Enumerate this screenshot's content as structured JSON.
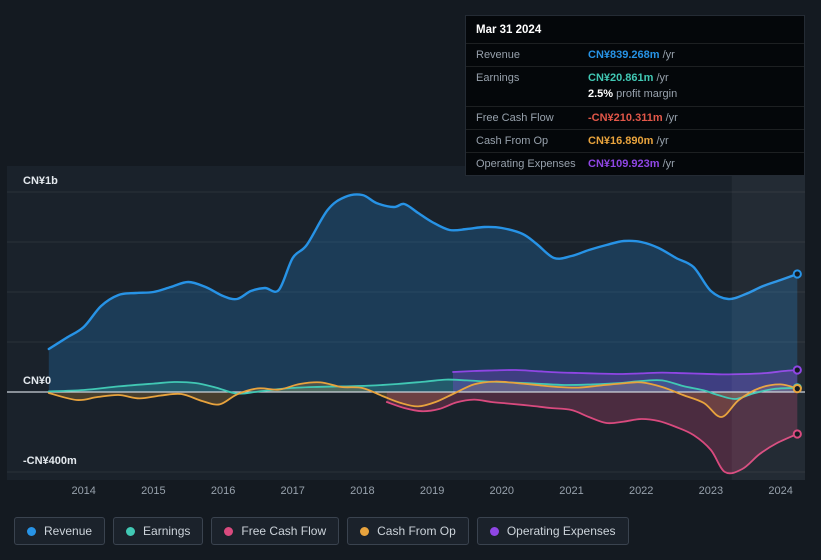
{
  "colors": {
    "page-bg": "#141a21",
    "plot-bg": "#1a222b",
    "revenue": "#2793e6",
    "earnings": "#41c8b4",
    "fcf": "#d94a7e",
    "fcf-neg": "#e25749",
    "cashop": "#e8a33d",
    "opex": "#8f46e4",
    "zero-line": "#ccd3da",
    "text": "#e4e9ee",
    "text-muted": "#97a1ac"
  },
  "tooltip": {
    "date": "Mar 31 2024",
    "rows": [
      {
        "label": "Revenue",
        "value": "CN¥839.268m",
        "suffix": "/yr"
      },
      {
        "label": "Earnings",
        "value": "CN¥20.861m",
        "suffix": "/yr"
      },
      {
        "label": "Free Cash Flow",
        "value": "-CN¥210.311m",
        "suffix": "/yr"
      },
      {
        "label": "Cash From Op",
        "value": "CN¥16.890m",
        "suffix": "/yr"
      },
      {
        "label": "Operating Expenses",
        "value": "CN¥109.923m",
        "suffix": "/yr"
      }
    ],
    "profit_margin": {
      "value": "2.5%",
      "text": "profit margin"
    }
  },
  "legend": [
    {
      "label": "Revenue",
      "color_key": "revenue"
    },
    {
      "label": "Earnings",
      "color_key": "earnings"
    },
    {
      "label": "Free Cash Flow",
      "color_key": "fcf"
    },
    {
      "label": "Cash From Op",
      "color_key": "cashop"
    },
    {
      "label": "Operating Expenses",
      "color_key": "opex"
    }
  ],
  "chart_data": {
    "type": "area",
    "unit": "CN¥ millions per year",
    "xlim": [
      2012.9,
      2024.35
    ],
    "ylim": [
      -440,
      1130
    ],
    "x_ticks": [
      2014,
      2015,
      2016,
      2017,
      2018,
      2019,
      2020,
      2021,
      2022,
      2023,
      2024
    ],
    "y_ticks": [
      {
        "value": 1000,
        "label": "CN¥1b"
      },
      {
        "value": 0,
        "label": "CN¥0"
      },
      {
        "value": -400,
        "label": "-CN¥400m"
      }
    ],
    "grid_values": [
      1000,
      750,
      500,
      250,
      -400
    ],
    "highlight_band": [
      2023.3,
      2024.35
    ],
    "legend_position": "bottom-left",
    "series": [
      {
        "name": "Revenue",
        "color_key": "revenue",
        "x": [
          2013.5,
          2013.75,
          2014,
          2014.25,
          2014.5,
          2014.75,
          2015,
          2015.25,
          2015.5,
          2015.75,
          2016,
          2016.2,
          2016.4,
          2016.6,
          2016.8,
          2017,
          2017.2,
          2017.5,
          2017.75,
          2018,
          2018.2,
          2018.45,
          2018.6,
          2018.8,
          2019,
          2019.25,
          2019.5,
          2019.75,
          2020,
          2020.3,
          2020.5,
          2020.75,
          2021,
          2021.25,
          2021.5,
          2021.75,
          2022,
          2022.25,
          2022.5,
          2022.75,
          2023,
          2023.25,
          2023.5,
          2023.75,
          2024,
          2024.24
        ],
        "values": [
          215,
          270,
          325,
          430,
          485,
          495,
          500,
          525,
          550,
          525,
          480,
          465,
          505,
          520,
          510,
          670,
          735,
          910,
          975,
          985,
          945,
          925,
          940,
          895,
          850,
          810,
          815,
          825,
          820,
          790,
          740,
          670,
          680,
          710,
          735,
          755,
          750,
          720,
          670,
          625,
          505,
          465,
          490,
          530,
          560,
          590
        ]
      },
      {
        "name": "Earnings",
        "color_key": "earnings",
        "x": [
          2013.5,
          2014,
          2014.5,
          2015,
          2015.3,
          2015.6,
          2015.9,
          2016.2,
          2016.5,
          2016.9,
          2017.3,
          2017.7,
          2018.1,
          2018.5,
          2018.9,
          2019.2,
          2019.5,
          2019.8,
          2020.1,
          2020.5,
          2020.9,
          2021.3,
          2021.7,
          2022,
          2022.3,
          2022.6,
          2022.9,
          2023.1,
          2023.35,
          2023.6,
          2023.9,
          2024.24
        ],
        "values": [
          3,
          10,
          28,
          42,
          50,
          45,
          22,
          -8,
          2,
          18,
          25,
          28,
          32,
          40,
          52,
          62,
          58,
          52,
          48,
          42,
          35,
          38,
          45,
          55,
          58,
          30,
          8,
          -15,
          -35,
          -8,
          15,
          21
        ]
      },
      {
        "name": "Cash From Op",
        "color_key": "cashop",
        "x": [
          2013.5,
          2013.9,
          2014.2,
          2014.5,
          2014.8,
          2015.1,
          2015.4,
          2015.7,
          2015.95,
          2016.2,
          2016.5,
          2016.8,
          2017.1,
          2017.4,
          2017.7,
          2018,
          2018.3,
          2018.55,
          2018.8,
          2019.05,
          2019.3,
          2019.6,
          2019.9,
          2020.2,
          2020.5,
          2020.8,
          2021.1,
          2021.4,
          2021.7,
          2022,
          2022.3,
          2022.6,
          2022.9,
          2023.15,
          2023.4,
          2023.7,
          2024,
          2024.24
        ],
        "values": [
          -5,
          -40,
          -25,
          -15,
          -32,
          -18,
          -10,
          -45,
          -62,
          -12,
          18,
          12,
          40,
          48,
          25,
          20,
          -22,
          -55,
          -72,
          -50,
          -10,
          38,
          52,
          45,
          35,
          25,
          22,
          32,
          42,
          48,
          25,
          -15,
          -55,
          -125,
          -40,
          20,
          38,
          17
        ]
      },
      {
        "name": "Free Cash Flow",
        "color_key": "fcf",
        "x": [
          2018.35,
          2018.6,
          2018.85,
          2019.1,
          2019.35,
          2019.6,
          2019.85,
          2020.1,
          2020.4,
          2020.7,
          2021,
          2021.25,
          2021.5,
          2021.75,
          2022,
          2022.25,
          2022.5,
          2022.75,
          2023,
          2023.2,
          2023.45,
          2023.7,
          2023.95,
          2024.24
        ],
        "values": [
          -50,
          -80,
          -96,
          -85,
          -52,
          -38,
          -50,
          -58,
          -68,
          -80,
          -90,
          -125,
          -155,
          -148,
          -135,
          -145,
          -175,
          -215,
          -290,
          -400,
          -385,
          -310,
          -255,
          -210
        ]
      },
      {
        "name": "Operating Expenses",
        "color_key": "opex",
        "x": [
          2019.3,
          2019.6,
          2019.9,
          2020.2,
          2020.5,
          2020.8,
          2021.1,
          2021.4,
          2021.7,
          2022,
          2022.3,
          2022.6,
          2022.9,
          2023.2,
          2023.5,
          2023.8,
          2024.05,
          2024.24
        ],
        "values": [
          100,
          105,
          108,
          110,
          104,
          98,
          95,
          92,
          90,
          93,
          97,
          94,
          91,
          88,
          90,
          95,
          105,
          110
        ]
      }
    ]
  }
}
